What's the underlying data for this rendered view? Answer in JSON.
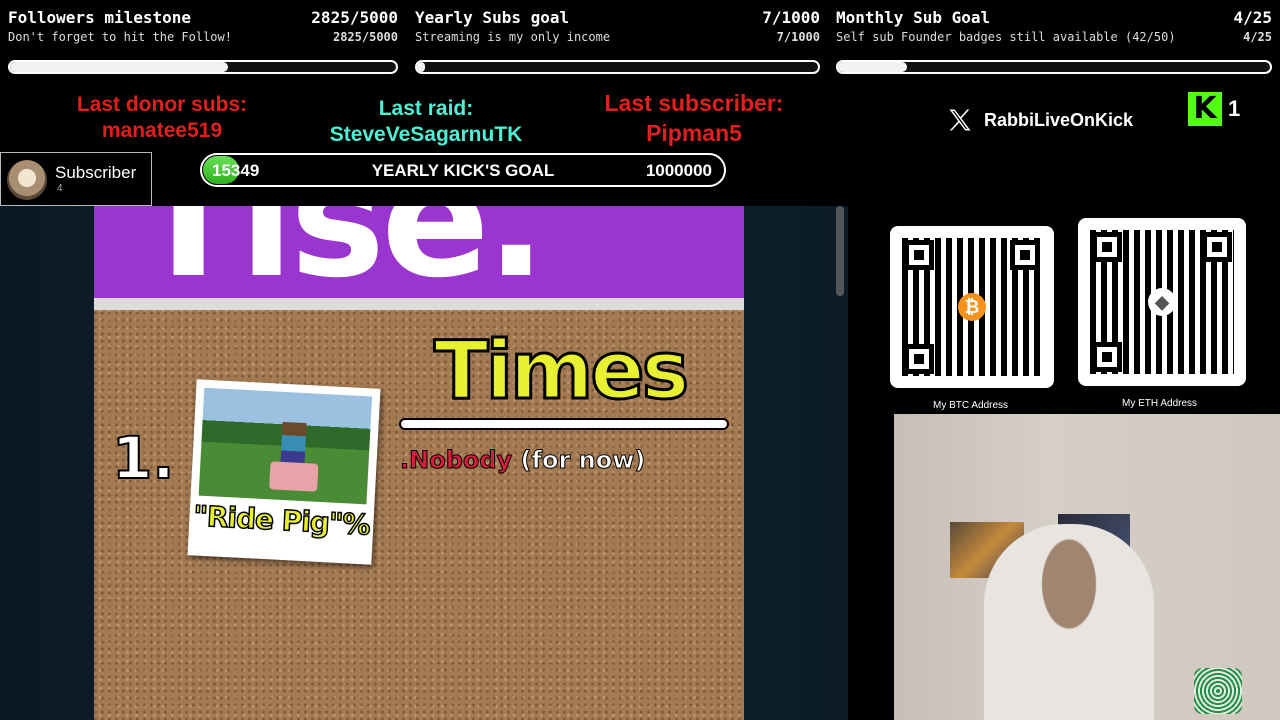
{
  "goals": [
    {
      "title": "Followers milestone",
      "count": "2825/5000",
      "subtitle": "Don't forget to hit the Follow!",
      "count2": "2825/5000",
      "progress": 0.565
    },
    {
      "title": "Yearly Subs goal",
      "count": "7/1000",
      "subtitle": "Streaming is my only income",
      "count2": "7/1000",
      "progress": 0.007
    },
    {
      "title": "Monthly Sub Goal",
      "count": "4/25",
      "subtitle": "Self sub Founder badges still available (42/50)",
      "count2": "4/25",
      "progress": 0.16
    }
  ],
  "last_donor": {
    "label": "Last donor subs:",
    "name": "manatee519"
  },
  "last_raid": {
    "label": "Last raid:",
    "name": "SteveVeSagarnuTK"
  },
  "last_subscriber": {
    "label": "Last subscriber:",
    "name": "Pipman5"
  },
  "social": {
    "x_handle": "RabbiLiveOnKick",
    "kick_count": "1"
  },
  "subscriber_alert": {
    "label": "Subscriber",
    "count": "4"
  },
  "kick_goal": {
    "current": "15349",
    "label": "YEARLY KICK'S GOAL",
    "target": "1000000"
  },
  "video": {
    "top_word": "Tise.",
    "heading": "Times",
    "rank": "1.",
    "card_caption": "\"Ride Pig\"%",
    "holder_name": ".Nobody",
    "holder_note": "(for now)"
  },
  "qr": {
    "btc_label": "My BTC Address",
    "eth_label": "My ETH Address",
    "btc_icon": "bitcoin-icon",
    "eth_icon": "ethereum-icon"
  },
  "colors": {
    "red": "#e0201e",
    "cyan": "#4ef0d6",
    "kick_green": "#53fc18",
    "purple": "#9a35cf",
    "yellow": "#e8f032"
  }
}
